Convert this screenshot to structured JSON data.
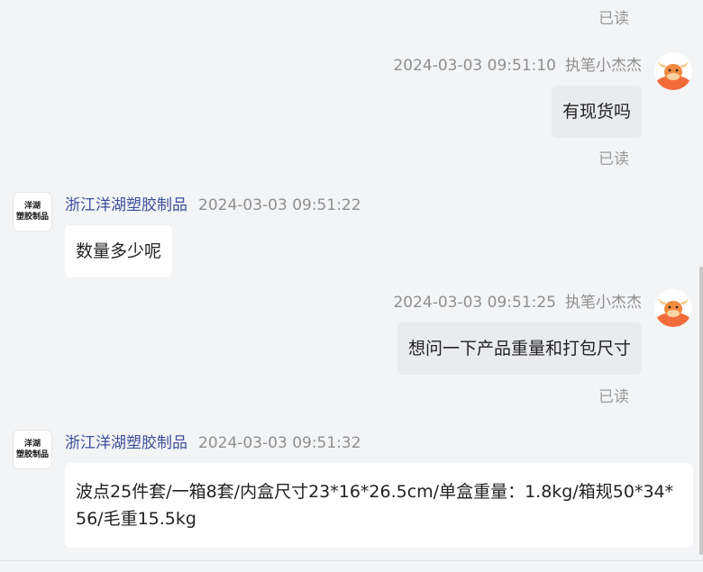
{
  "read_label": "已读",
  "messages": [
    {
      "timestamp": "2024-03-03 09:51:10",
      "sender": "执笔小杰杰",
      "text": "有现货吗"
    },
    {
      "timestamp": "2024-03-03 09:51:22",
      "sender": "浙江洋湖塑胶制品",
      "text": "数量多少呢"
    },
    {
      "timestamp": "2024-03-03 09:51:25",
      "sender": "执笔小杰杰",
      "text": "想问一下产品重量和打包尺寸"
    },
    {
      "timestamp": "2024-03-03 09:51:32",
      "sender": "浙江洋湖塑胶制品",
      "text": "波点25件套/一箱8套/内盒尺寸23*16*26.5cm/单盒重量：1.8kg/箱规50*34*56/毛重15.5kg"
    }
  ],
  "shop_avatar_text": [
    "洋湖",
    "塑胶制品"
  ],
  "colors": {
    "background": "#f3f4f6",
    "my_bubble": "#e9ebee",
    "their_bubble": "#ffffff",
    "shop_name": "#3c4f9c",
    "avatar_orange": "#f26b3a"
  }
}
